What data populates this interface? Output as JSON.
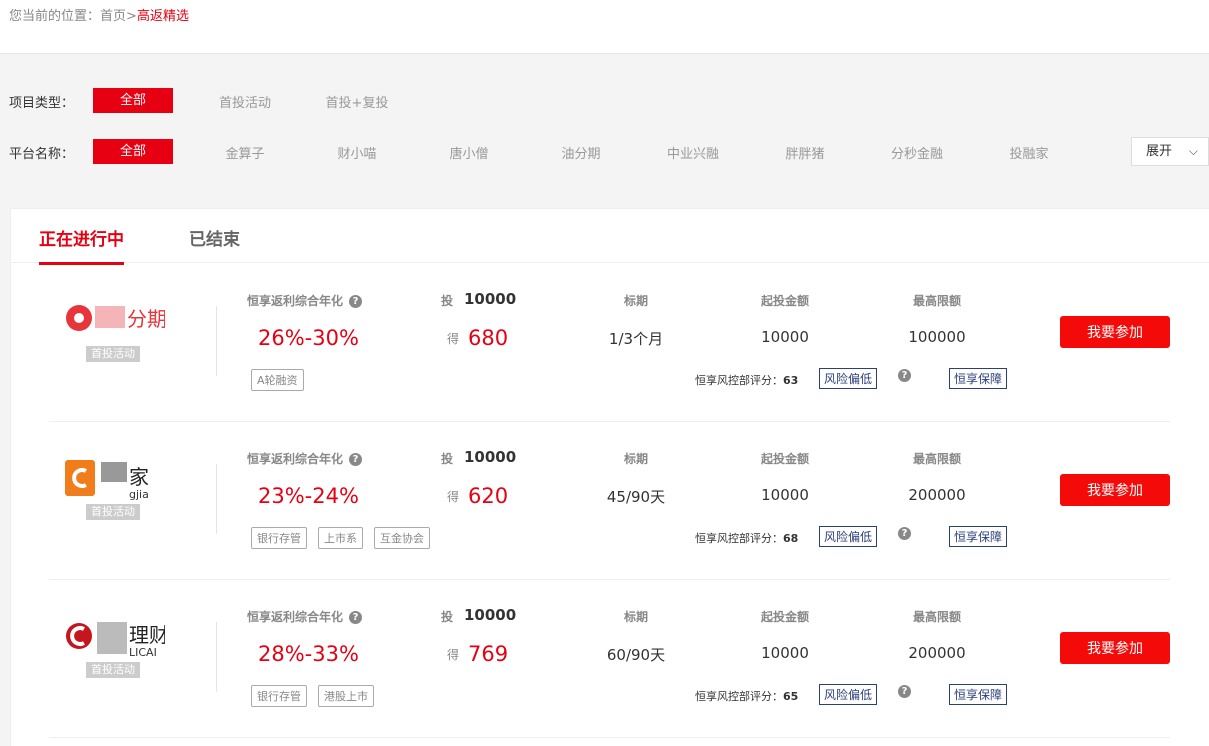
{
  "breadcrumb": {
    "prefix": "您当前的位置：",
    "home": "首页",
    "sep": ">",
    "current": "高返精选"
  },
  "filters": {
    "type_label": "项目类型：",
    "type_options": [
      "全部",
      "首投活动",
      "首投+复投"
    ],
    "platform_label": "平台名称：",
    "platform_options": [
      "全部",
      "金算子",
      "财小喵",
      "唐小僧",
      "油分期",
      "中业兴融",
      "胖胖猪",
      "分秒金融",
      "投融家"
    ],
    "expand_label": "展开"
  },
  "tabs": [
    "正在进行中",
    "已结束"
  ],
  "labels": {
    "rate": "恒享返利综合年化",
    "invest": "投",
    "get": "得",
    "term": "标期",
    "min": "起投金额",
    "max": "最高限额",
    "risk_prefix": "恒享风控部评分：",
    "risk_tag": "风险偏低",
    "guarantee_tag": "恒享保障",
    "join": "我要参加",
    "badge": "首投活动"
  },
  "colors": {
    "accent": "#e60012",
    "button": "#f50a0a",
    "navy": "#2b3f7a"
  },
  "products": [
    {
      "logo_text": "分期",
      "logo_color": "#e8343b",
      "rate": "26%-30%",
      "invest": "10000",
      "get": "680",
      "term": "1/3个月",
      "min": "10000",
      "max": "100000",
      "tags": [
        "A轮融资"
      ],
      "score": "63"
    },
    {
      "logo_text": "家",
      "logo_sub": "gjia",
      "logo_color": "#f07c1a",
      "rate": "23%-24%",
      "invest": "10000",
      "get": "620",
      "term": "45/90天",
      "min": "10000",
      "max": "200000",
      "tags": [
        "银行存管",
        "上市系",
        "互金协会"
      ],
      "score": "68"
    },
    {
      "logo_text": "理财",
      "logo_sub": "LICAI",
      "logo_color": "#c4161c",
      "rate": "28%-33%",
      "invest": "10000",
      "get": "769",
      "term": "60/90天",
      "min": "10000",
      "max": "200000",
      "tags": [
        "银行存管",
        "港股上市"
      ],
      "score": "65"
    }
  ]
}
